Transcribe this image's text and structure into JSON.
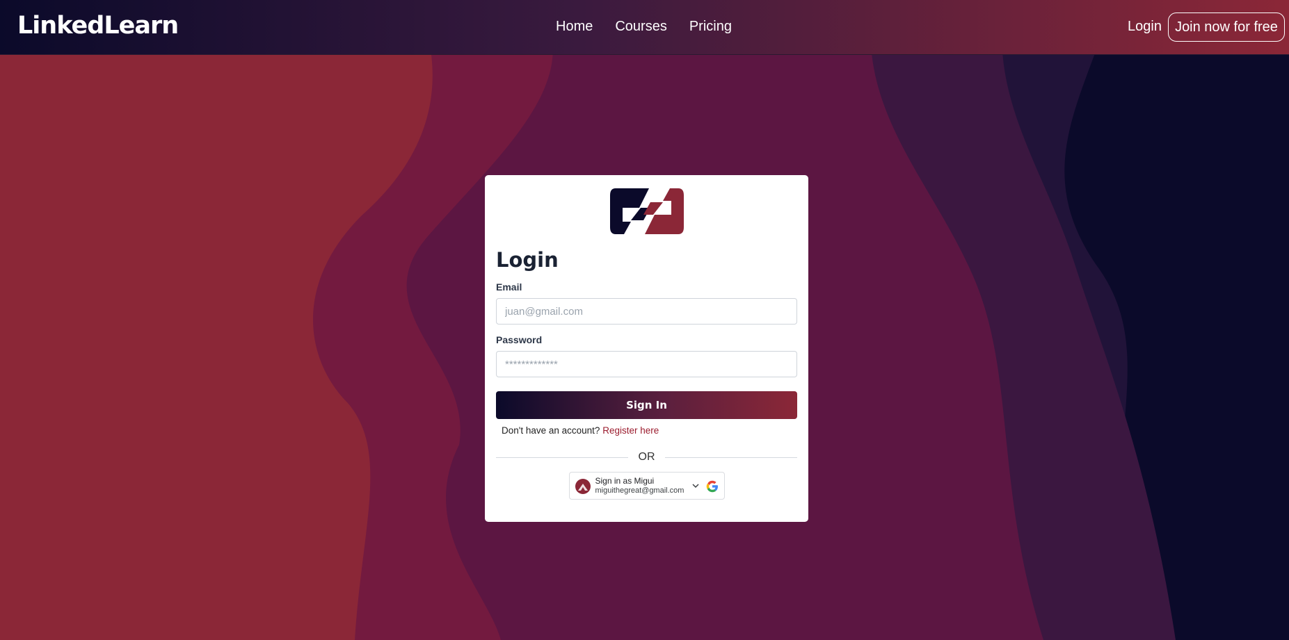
{
  "navbar": {
    "brand": "LinkedLearn",
    "links": [
      "Home",
      "Courses",
      "Pricing"
    ],
    "login_label": "Login",
    "join_label": "Join now for free"
  },
  "login_card": {
    "title": "Login",
    "email": {
      "label": "Email",
      "placeholder": "juan@gmail.com",
      "value": ""
    },
    "password": {
      "label": "Password",
      "placeholder": "*************",
      "value": ""
    },
    "submit_label": "Sign In",
    "register_prompt": "Don't have an account?",
    "register_link": "Register here",
    "divider_text": "OR",
    "google_signin": {
      "name_line": "Sign in as Migui",
      "email_line": "miguithegreat@gmail.com"
    }
  },
  "colors": {
    "navy": "#0b0a2a",
    "crimson": "#8b2737",
    "link": "#9b1c2e"
  },
  "icons": [
    "brand-logo-icon",
    "user-avatar-icon",
    "chevron-down-icon",
    "google-icon"
  ]
}
